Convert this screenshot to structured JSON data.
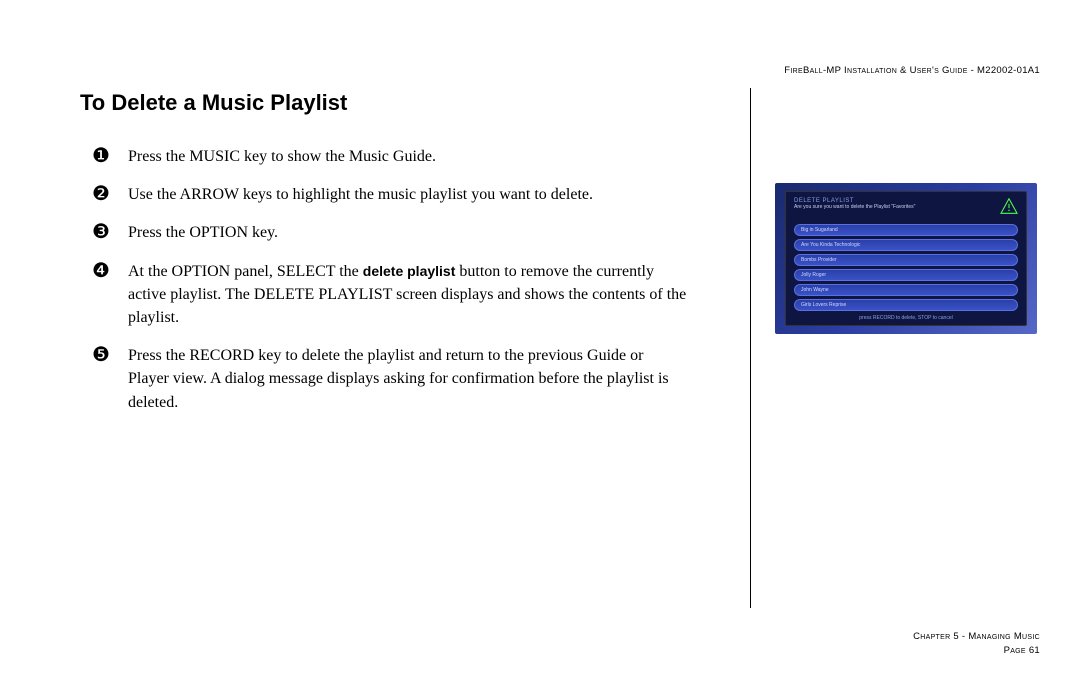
{
  "header": "FireBall-MP Installation & User's Guide - M22002-01A1",
  "heading": "To Delete a Music Playlist",
  "steps": [
    {
      "num": "❶",
      "text": "Press the MUSIC key to show the Music Guide."
    },
    {
      "num": "❷",
      "text": "Use the ARROW keys to highlight the music playlist you want to delete."
    },
    {
      "num": "❸",
      "text": "Press the OPTION key."
    },
    {
      "num": "❹",
      "text_a": "At the OPTION panel, SELECT the ",
      "bold": "delete playlist",
      "text_b": " button to remove the currently active playlist. The DELETE PLAYLIST screen displays and shows the contents of the playlist."
    },
    {
      "num": "❺",
      "text": "Press the RECORD key to delete the playlist and return to the previous Guide or Player view.  A dialog message displays asking for confirmation before the playlist is deleted."
    }
  ],
  "screenshot": {
    "title": "DELETE PLAYLIST",
    "subtitle": "Are you sure you want to delete the Playlist \"Favorites\"",
    "rows": [
      "Big in Sugarland",
      "Are You Kinda Technologic",
      "Bombs Provider",
      "Jolly Roger",
      "John Wayne",
      "Girls Lovers Reprise"
    ],
    "footer": "press RECORD to delete, STOP to cancel"
  },
  "footer": {
    "chapter": "Chapter 5 - Managing Music",
    "page": "Page 61"
  }
}
